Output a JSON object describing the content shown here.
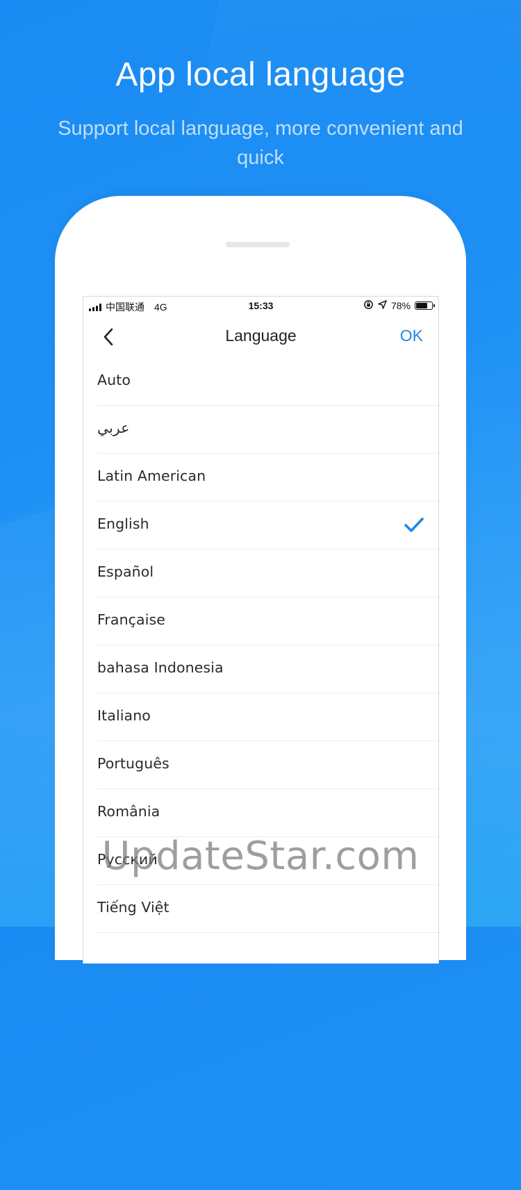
{
  "promo": {
    "headline": "App local language",
    "subline": "Support local language, more convenient and quick"
  },
  "status_bar": {
    "carrier": "中国联通",
    "network": "4G",
    "time": "15:33",
    "battery_percent": "78%",
    "battery_level": 0.78
  },
  "nav": {
    "title": "Language",
    "ok_label": "OK"
  },
  "languages": [
    {
      "label": "Auto",
      "selected": false
    },
    {
      "label": "عربي",
      "selected": false
    },
    {
      "label": "Latin American",
      "selected": false
    },
    {
      "label": "English",
      "selected": true
    },
    {
      "label": "Español",
      "selected": false
    },
    {
      "label": "Française",
      "selected": false
    },
    {
      "label": "bahasa Indonesia",
      "selected": false
    },
    {
      "label": "Italiano",
      "selected": false
    },
    {
      "label": "Português",
      "selected": false
    },
    {
      "label": "România",
      "selected": false
    },
    {
      "label": "Русский",
      "selected": false
    },
    {
      "label": "Tiếng Việt",
      "selected": false
    }
  ],
  "colors": {
    "accent": "#1f86e6",
    "background": "#1e90f5"
  },
  "watermark": "UpdateStar.com"
}
